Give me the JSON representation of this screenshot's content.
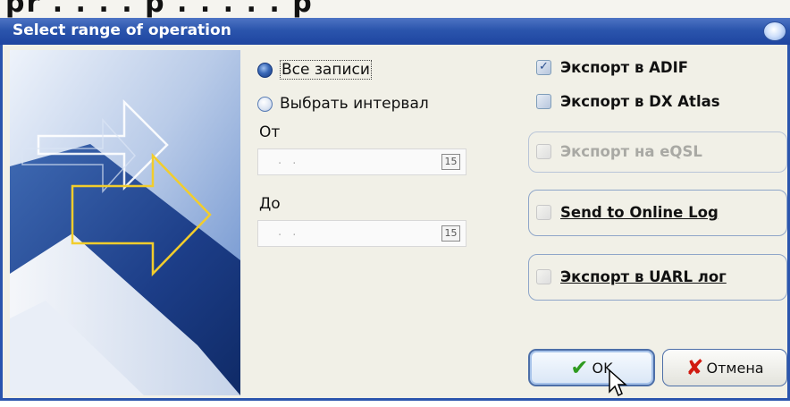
{
  "colors": {
    "titlebar": "#2b55ad",
    "dialog_bg": "#f1f0e7",
    "accent_check": "#2e9a1f",
    "accent_cancel": "#d11b10"
  },
  "background_window": {
    "partial_title": "pr . . . . p . . . . . p"
  },
  "dialog": {
    "title": "Select range of operation"
  },
  "range": {
    "all_records": "Все записи",
    "choose_interval": "Выбрать интервал",
    "from_label": "От",
    "to_label": "До",
    "from_value": ". .",
    "to_value": ". .",
    "calendar_icon_text": "15"
  },
  "export_options": {
    "adif": "Экспорт в ADIF",
    "dx_atlas": "Экспорт в DX Atlas",
    "eqsl": "Экспорт на eQSL",
    "online_log": "Send to Online Log",
    "uarl": "Экспорт в UARL лог",
    "adif_checked": true,
    "dx_atlas_checked": false,
    "eqsl_checked": false,
    "online_log_checked": false,
    "uarl_checked": false
  },
  "buttons": {
    "ok": "OK",
    "cancel": "Отмена"
  },
  "icons": {
    "ok": "check-icon",
    "cancel": "x-icon",
    "calendar": "calendar-icon",
    "cursor": "mouse-pointer-icon"
  }
}
